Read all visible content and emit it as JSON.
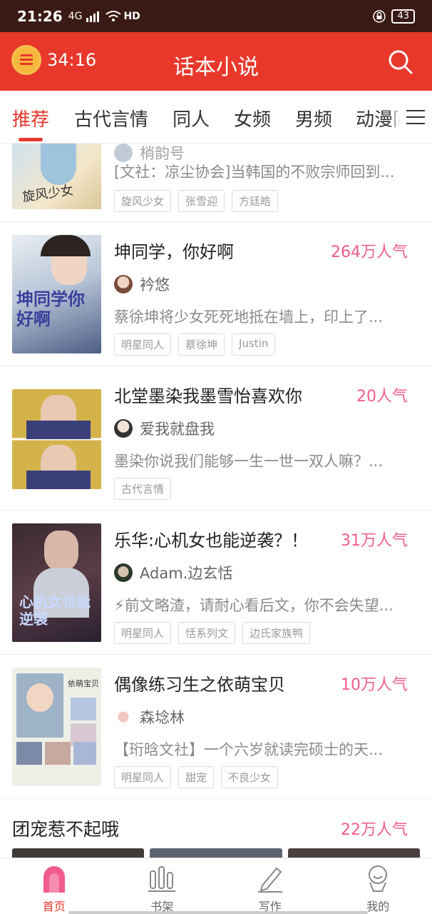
{
  "status": {
    "time": "21:26",
    "network": "4G",
    "hd": "HD",
    "battery": "43"
  },
  "header": {
    "timer": "34:16",
    "title": "话本小说"
  },
  "tabs": [
    "推荐",
    "古代言情",
    "同人",
    "女频",
    "男频",
    "动漫同"
  ],
  "partial_item": {
    "author": "梢韵号",
    "desc": "[文社：凉尘协会]当韩国的不败宗师回到...",
    "tags": [
      "旋风少女",
      "张雪迎",
      "方廷皓"
    ]
  },
  "items": [
    {
      "title": "坤同学，你好啊",
      "popularity": "264万人气",
      "author": "衿悠",
      "desc": "蔡徐坤将少女死死地抵在墙上，印上了...",
      "tags": [
        "明星同人",
        "蔡徐坤",
        "Justin"
      ],
      "cover_text": "坤同学你好啊"
    },
    {
      "title": "北堂墨染我墨雪怡喜欢你",
      "popularity": "20人气",
      "author": "爱我就盘我",
      "desc": "墨染你说我们能够一生一世一双人嘛？...",
      "tags": [
        "古代言情"
      ],
      "cover_text": ""
    },
    {
      "title": "乐华:心机女也能逆袭？！",
      "popularity": "31万人气",
      "author": "Adam.边玄恬",
      "desc": "⚡前文略渣，请耐心看后文，你不会失望...",
      "tags": [
        "明星同人",
        "恬系列文",
        "边氏家族鸭"
      ],
      "cover_text": "心机女也能逆袭"
    },
    {
      "title": "偶像练习生之依萌宝贝",
      "popularity": "10万人气",
      "author": "森埝林",
      "desc": "【珩晗文社】一个六岁就读完硕士的天...",
      "tags": [
        "明星同人",
        "甜宠",
        "不良少女"
      ],
      "cover_text": "依萌宝贝"
    }
  ],
  "big_row": {
    "title": "团宠惹不起哦",
    "popularity": "22万人气"
  },
  "bottom_nav": [
    {
      "label": "首页",
      "icon": "home-icon"
    },
    {
      "label": "书架",
      "icon": "bookshelf-icon"
    },
    {
      "label": "写作",
      "icon": "pencil-icon"
    },
    {
      "label": "我的",
      "icon": "profile-icon"
    }
  ],
  "colors": {
    "brand": "#e8382c",
    "popularity": "#ef5d8f",
    "status_bar": "#3a1a14"
  }
}
